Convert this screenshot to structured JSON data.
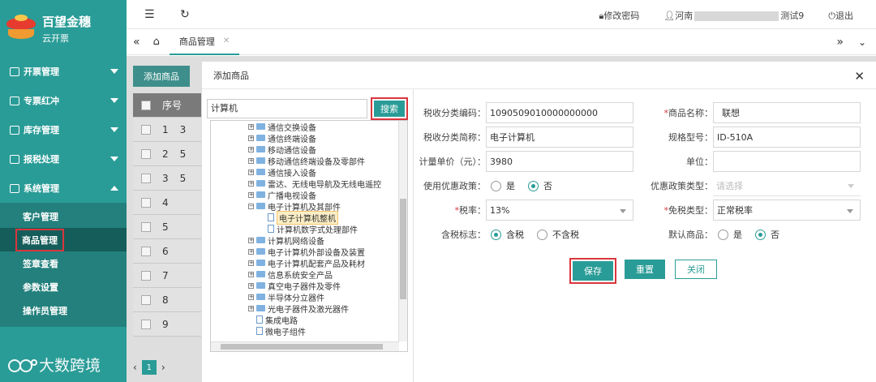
{
  "brand": {
    "title": "百望金穗",
    "subtitle": "云开票"
  },
  "sidebar": {
    "menus": [
      {
        "label": "开票管理"
      },
      {
        "label": "专票红冲"
      },
      {
        "label": "库存管理"
      },
      {
        "label": "报税处理"
      },
      {
        "label": "系统管理"
      }
    ],
    "submenu": [
      {
        "label": "客户管理"
      },
      {
        "label": "商品管理"
      },
      {
        "label": "签章查看"
      },
      {
        "label": "参数设置"
      },
      {
        "label": "操作员管理"
      }
    ],
    "watermark": "大数跨境"
  },
  "topbar": {
    "change_password": "修改密码",
    "user_prefix": "河南",
    "user_suffix": "测试9",
    "logout": "退出"
  },
  "tabs": {
    "active": "商品管理"
  },
  "background": {
    "add_button": "添加商品",
    "header_col": "序号",
    "rows": [
      "1",
      "2",
      "3",
      "4",
      "5",
      "6",
      "7",
      "8",
      "9"
    ],
    "row_codes": [
      "3",
      "5",
      "5",
      "",
      "",
      "",
      "",
      "",
      ""
    ],
    "page": "1"
  },
  "modal": {
    "title": "添加商品",
    "search": {
      "value": "计算机",
      "button": "搜索"
    },
    "tree": [
      "通信交换设备",
      "通信终端设备",
      "移动通信设备",
      "移动通信终端设备及零部件",
      "通信接入设备",
      "雷达、无线电导航及无线电遥控",
      "广播电视设备",
      "电子计算机及其部件",
      "电子计算机整机",
      "计算机数字式处理部件",
      "计算机网络设备",
      "电子计算机外部设备及装置",
      "电子计算机配套产品及耗材",
      "信息系统安全产品",
      "真空电子器件及零件",
      "半导体分立器件",
      "光电子器件及激光器件",
      "集成电路",
      "微电子组件"
    ],
    "form": {
      "tax_code_label": "税收分类编码：",
      "tax_code_value": "1090509010000000000",
      "tax_short_label": "税收分类简称：",
      "tax_short_value": "电子计算机",
      "unit_price_label": "计量单价（元）：",
      "unit_price_value": "3980",
      "preferential_label": "使用优惠政策：",
      "yes": "是",
      "no": "否",
      "tax_rate_label": "税率：",
      "tax_rate_value": "13%",
      "tax_inclusive_label": "含税标志：",
      "incl": "含税",
      "excl": "不含税",
      "name_label": "商品名称：",
      "name_value": "联想",
      "model_label": "规格型号：",
      "model_value": "ID-510A",
      "unit_label": "单位：",
      "unit_value": "",
      "policy_type_label": "优惠政策类型：",
      "policy_type_placeholder": "请选择",
      "exempt_label": "免税类型：",
      "exempt_value": "正常税率",
      "default_label": "默认商品："
    },
    "buttons": {
      "save": "保存",
      "reset": "重置",
      "close": "关闭"
    }
  }
}
